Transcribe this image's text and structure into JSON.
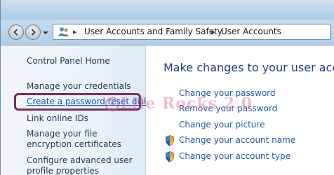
{
  "navigation": {
    "breadcrumbs": [
      "User Accounts and Family Safety",
      "User Accounts"
    ]
  },
  "sidebar": {
    "home_label": "Control Panel Home",
    "items": [
      {
        "label": "Manage your credentials"
      },
      {
        "label": "Create a password reset disk"
      },
      {
        "label": "Link online IDs"
      },
      {
        "label": "Manage your file encryption certificates"
      },
      {
        "label": "Configure advanced user profile properties"
      }
    ]
  },
  "main": {
    "title": "Make changes to your user account",
    "tasks": [
      {
        "label": "Change your password",
        "icon": "none"
      },
      {
        "label": "Remove your password",
        "icon": "none"
      },
      {
        "label": "Change your picture",
        "icon": "none"
      },
      {
        "label": "Change your account name",
        "icon": "uac-shield-icon"
      },
      {
        "label": "Change your account type",
        "icon": "uac-shield-icon"
      }
    ]
  },
  "watermark": {
    "text": "Life Rocks 2.0"
  },
  "colors": {
    "highlight_border": "#7b2a62",
    "link": "#1e56b3",
    "title": "#1e3f8a"
  }
}
